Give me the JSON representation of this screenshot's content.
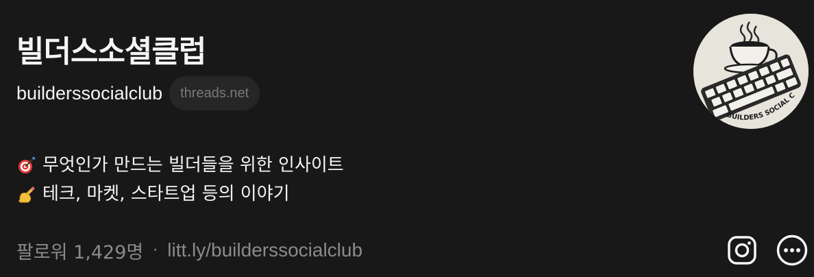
{
  "profile": {
    "display_name": "빌더스소셜클럽",
    "username": "builderssocialclub",
    "domain_badge": "threads.net",
    "avatar_text": "BUILDERS SOCIAL CLUB"
  },
  "bio": {
    "lines": [
      {
        "emoji": "target-icon",
        "text": "무엇인가 만드는 빌더들을 위한 인사이트"
      },
      {
        "emoji": "writing-hand-icon",
        "text": "테크, 마켓, 스타트업 등의 이야기"
      }
    ]
  },
  "footer": {
    "followers": "팔로워 1,429명",
    "separator": "·",
    "link": "litt.ly/builderssocialclub"
  },
  "actions": {
    "instagram_icon": "instagram-icon",
    "more_icon": "more-icon"
  },
  "colors": {
    "background": "#181818",
    "primary_text": "#f3f5f7",
    "secondary_text": "#8a8a8a",
    "pill_background": "#262626"
  }
}
